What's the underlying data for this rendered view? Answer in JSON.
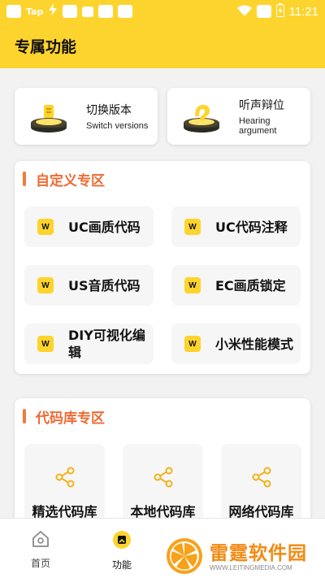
{
  "status_bar": {
    "app_label": "Tap",
    "time": "11:21"
  },
  "header": {
    "title": "专属功能"
  },
  "quick_cards": [
    {
      "title": "切换版本",
      "subtitle": "Switch versions",
      "icon": "version-switch-icon"
    },
    {
      "title": "听声辩位",
      "subtitle": "Hearing argument",
      "icon": "hearing-icon"
    }
  ],
  "custom_section": {
    "title": "自定义专区",
    "items": [
      {
        "label": "UC画质代码",
        "icon": "w-icon"
      },
      {
        "label": "UC代码注释",
        "icon": "w-icon"
      },
      {
        "label": "US音质代码",
        "icon": "w-icon"
      },
      {
        "label": "EC画质锁定",
        "icon": "w-icon"
      },
      {
        "label": "DIY可视化编辑",
        "icon": "w-icon"
      },
      {
        "label": "小米性能模式",
        "icon": "w-icon"
      }
    ],
    "icon_letter": "W"
  },
  "library_section": {
    "title": "代码库专区",
    "items": [
      {
        "label": "精选代码库",
        "icon": "share-icon"
      },
      {
        "label": "本地代码库",
        "icon": "share-icon"
      },
      {
        "label": "网络代码库",
        "icon": "share-icon"
      }
    ]
  },
  "bottom_nav": {
    "items": [
      {
        "label": "首页",
        "icon": "home-icon",
        "active": false
      },
      {
        "label": "功能",
        "icon": "function-icon",
        "active": true
      }
    ]
  },
  "watermark": {
    "brand": "雷霆软件园",
    "url": "WWW.LEITINGMEDIA.COM"
  },
  "colors": {
    "accent_yellow": "#fdd42d",
    "section_orange": "#ee6a32",
    "background": "#f2f2f2"
  }
}
